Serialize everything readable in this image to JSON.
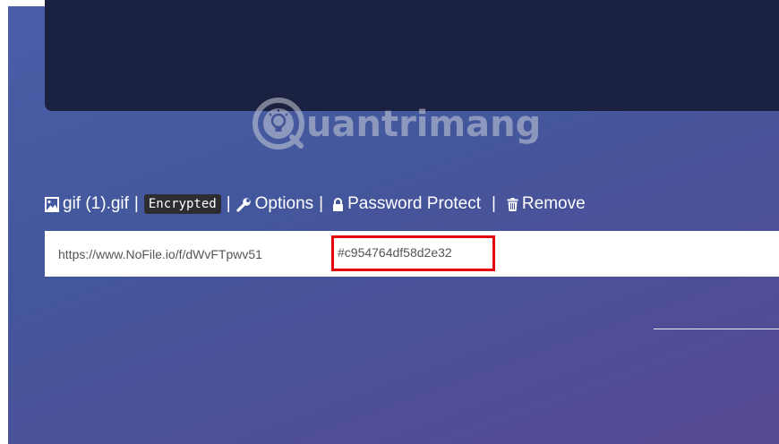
{
  "watermark": {
    "text": "uantrimang"
  },
  "file": {
    "name": "gif (1).gif",
    "separator": "|",
    "badge": "Encrypted",
    "options_label": "Options",
    "password_label": "Password Protect",
    "remove_label": "Remove"
  },
  "url": {
    "base": "https://www.NoFile.io/f/dWvFTpwv51",
    "key": "#c954764df58d2e32"
  },
  "icons": {
    "file": "image-file-icon",
    "options": "wrench-icon",
    "password": "lock-icon",
    "remove": "trash-icon"
  },
  "colors": {
    "highlight": "#e3000b",
    "panel": "#1b2140",
    "badge_bg": "#2b2d33"
  }
}
